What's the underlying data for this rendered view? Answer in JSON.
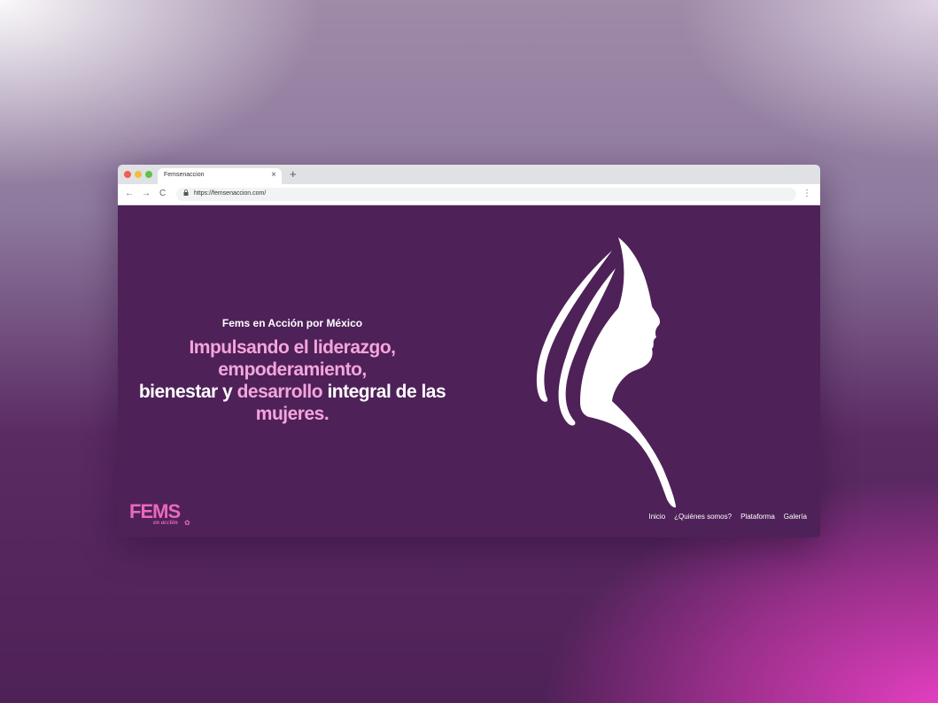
{
  "browser": {
    "tab_title": "Femsenaccion",
    "tab_close": "×",
    "new_tab": "+",
    "url": "https://femsenaccion.com/",
    "back_icon": "←",
    "forward_icon": "→",
    "reload_icon": "C",
    "menu_icon": "⋮"
  },
  "hero": {
    "subtitle": "Fems en Acción por México",
    "line1": "Impulsando el liderazgo,",
    "line2": "empoderamiento,",
    "line3_a": "bienestar y ",
    "line3_b": "desarrollo",
    "line3_c": " integral de las",
    "line4": "mujeres."
  },
  "logo": {
    "main": "FEMS",
    "sub": "en acción"
  },
  "nav": {
    "items": [
      "Inicio",
      "¿Quiénes somos?",
      "Plataforma",
      "Galería"
    ]
  },
  "colors": {
    "background": "#4e2258",
    "accent_pink": "#f4a5dc",
    "logo_pink": "#ea68bd"
  }
}
